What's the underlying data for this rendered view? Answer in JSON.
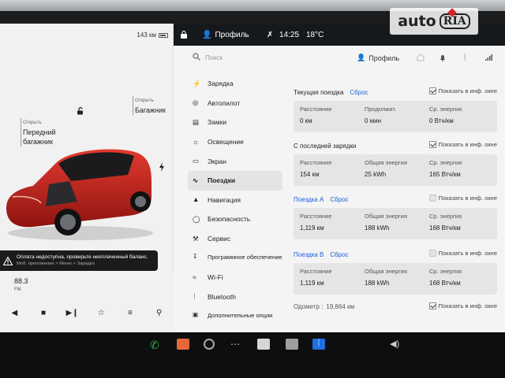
{
  "watermark": {
    "brand": "auto",
    "suffix": "RIA"
  },
  "status_bar": {
    "profile": "Профиль",
    "time": "14:25",
    "temperature": "18°C"
  },
  "car_panel": {
    "range": "143 км",
    "front_trunk": {
      "action": "Открыть",
      "label_line1": "Передний",
      "label_line2": "багажник"
    },
    "rear_trunk": {
      "action": "Открыть",
      "label": "Багажник"
    },
    "car_color": "#c0241f"
  },
  "alert": {
    "message": "Оплата недоступна, проверьте неоплаченный баланс.",
    "sub": "Моб. приложение > Меню > Зарядка"
  },
  "media": {
    "frequency": "88.3",
    "band": "FM"
  },
  "header": {
    "search_placeholder": "Поиск",
    "profile": "Профиль"
  },
  "menu": {
    "items": [
      {
        "label": "Зарядка",
        "icon": "charging-bolt-icon"
      },
      {
        "label": "Автопилот",
        "icon": "steering-wheel-icon"
      },
      {
        "label": "Замки",
        "icon": "lock-icon"
      },
      {
        "label": "Освещение",
        "icon": "sun-icon"
      },
      {
        "label": "Экран",
        "icon": "display-icon"
      },
      {
        "label": "Поездки",
        "icon": "trips-icon",
        "active": true
      },
      {
        "label": "Навигация",
        "icon": "navigation-arrow-icon"
      },
      {
        "label": "Безопасность",
        "icon": "shield-icon"
      },
      {
        "label": "Сервис",
        "icon": "wrench-icon"
      },
      {
        "label": "Программное обеспечение",
        "icon": "download-icon"
      },
      {
        "label": "Wi-Fi",
        "icon": "wifi-icon"
      },
      {
        "label": "Bluetooth",
        "icon": "bluetooth-icon"
      },
      {
        "label": "Дополнительные опции",
        "icon": "lock-plus-icon"
      }
    ]
  },
  "trips": {
    "show_in_car_label": "Показать в инф. окне",
    "current": {
      "title": "Текущая поездка",
      "reset": "Сброс",
      "show_checked": true,
      "stats": [
        {
          "label": "Расстояние",
          "value": "0 км"
        },
        {
          "label": "Продолжит.",
          "value": "0 мин"
        },
        {
          "label": "Ср. энергия",
          "value": "0 Втч/км"
        }
      ]
    },
    "since_charge": {
      "title": "С последней зарядки",
      "show_checked": true,
      "stats": [
        {
          "label": "Расстояние",
          "value": "154 км"
        },
        {
          "label": "Общая энергия",
          "value": "25 kWh"
        },
        {
          "label": "Ср. энергия",
          "value": "165 Втч/км"
        }
      ]
    },
    "trip_a": {
      "title": "Поездка A",
      "reset": "Сброс",
      "show_checked": false,
      "stats": [
        {
          "label": "Расстояние",
          "value": "1,119 км"
        },
        {
          "label": "Общая энергия",
          "value": "188 kWh"
        },
        {
          "label": "Ср. энергия",
          "value": "168 Втч/км"
        }
      ]
    },
    "trip_b": {
      "title": "Поездка B",
      "reset": "Сброс",
      "show_checked": false,
      "stats": [
        {
          "label": "Расстояние",
          "value": "1,119 км"
        },
        {
          "label": "Общая энергия",
          "value": "188 kWh"
        },
        {
          "label": "Ср. энергия",
          "value": "168 Втч/км"
        }
      ]
    },
    "odometer": {
      "label": "Одометр :",
      "value": "19,864 км",
      "show_checked": true
    }
  }
}
